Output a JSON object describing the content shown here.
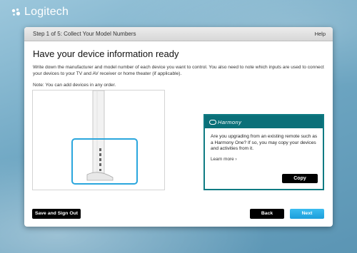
{
  "brand": {
    "name": "Logitech",
    "mark_icon": "logitech-mark-icon"
  },
  "dialog": {
    "step_title": "Step 1 of 5: Collect Your Model Numbers",
    "help_label": "Help",
    "heading": "Have your device information ready",
    "description": "Write down the manufacturer and model number of each device you want to control. You also need to note which inputs are used to connect your devices to your TV and AV receiver or home theater (if applicable).",
    "note": "Note: You can add devices in any order."
  },
  "harmony": {
    "logo": "Harmony",
    "text": "Are you upgrading from an existing remote such as a Harmony One? If so, you may copy your devices and activities from it.",
    "learn_more": "Learn more ›",
    "copy_label": "Copy",
    "accent_color": "#0b7079"
  },
  "footer": {
    "save_label": "Save and Sign Out",
    "back_label": "Back",
    "next_label": "Next"
  },
  "colors": {
    "highlight": "#2aa6dd",
    "background": "#6fa7c3"
  }
}
